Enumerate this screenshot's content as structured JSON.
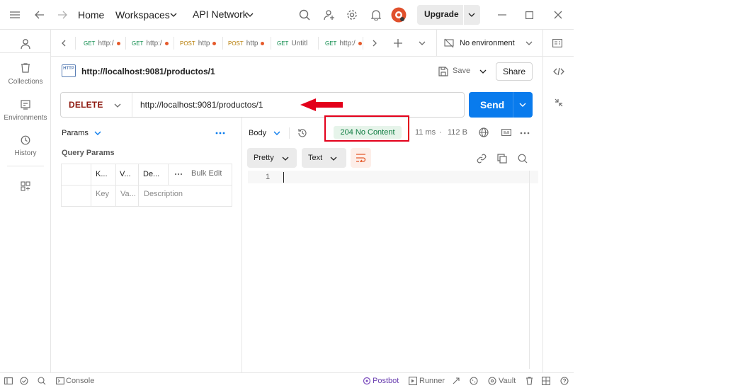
{
  "app": {
    "nav": {
      "home": "Home",
      "workspaces": "Workspaces",
      "api_network": "API Network"
    },
    "upgrade_label": "Upgrade"
  },
  "sidebar": {
    "items": [
      {
        "label": "Collections"
      },
      {
        "label": "Environments"
      },
      {
        "label": "History"
      }
    ]
  },
  "tabs": [
    {
      "method": "GET",
      "title": "http:/"
    },
    {
      "method": "GET",
      "title": "http:/"
    },
    {
      "method": "POST",
      "title": "http"
    },
    {
      "method": "POST",
      "title": "http"
    },
    {
      "method": "GET",
      "title": "Untitl"
    },
    {
      "method": "GET",
      "title": "http:/"
    }
  ],
  "environment": {
    "selected": "No environment"
  },
  "request": {
    "title": "http://localhost:9081/productos/1",
    "badge": "HTTP",
    "save_label": "Save",
    "share_label": "Share",
    "method": "DELETE",
    "url": "http://localhost:9081/productos/1",
    "send_label": "Send"
  },
  "params": {
    "section_label": "Params",
    "query_title": "Query Params",
    "headers": [
      "K...",
      "V...",
      "De..."
    ],
    "bulk_edit": "Bulk Edit",
    "placeholders": [
      "Key",
      "Va...",
      "Description"
    ]
  },
  "response": {
    "tab_label": "Body",
    "status": "204 No Content",
    "time": "11 ms",
    "size": "112 B",
    "format": "Pretty",
    "type": "Text",
    "line_number": "1"
  },
  "footer": {
    "console": "Console",
    "postbot": "Postbot",
    "runner": "Runner",
    "vault": "Vault"
  },
  "colors": {
    "send": "#097bed",
    "method_delete": "#8e1a10",
    "status_ok": "#0b7a3e",
    "annotation": "#e3001b"
  }
}
